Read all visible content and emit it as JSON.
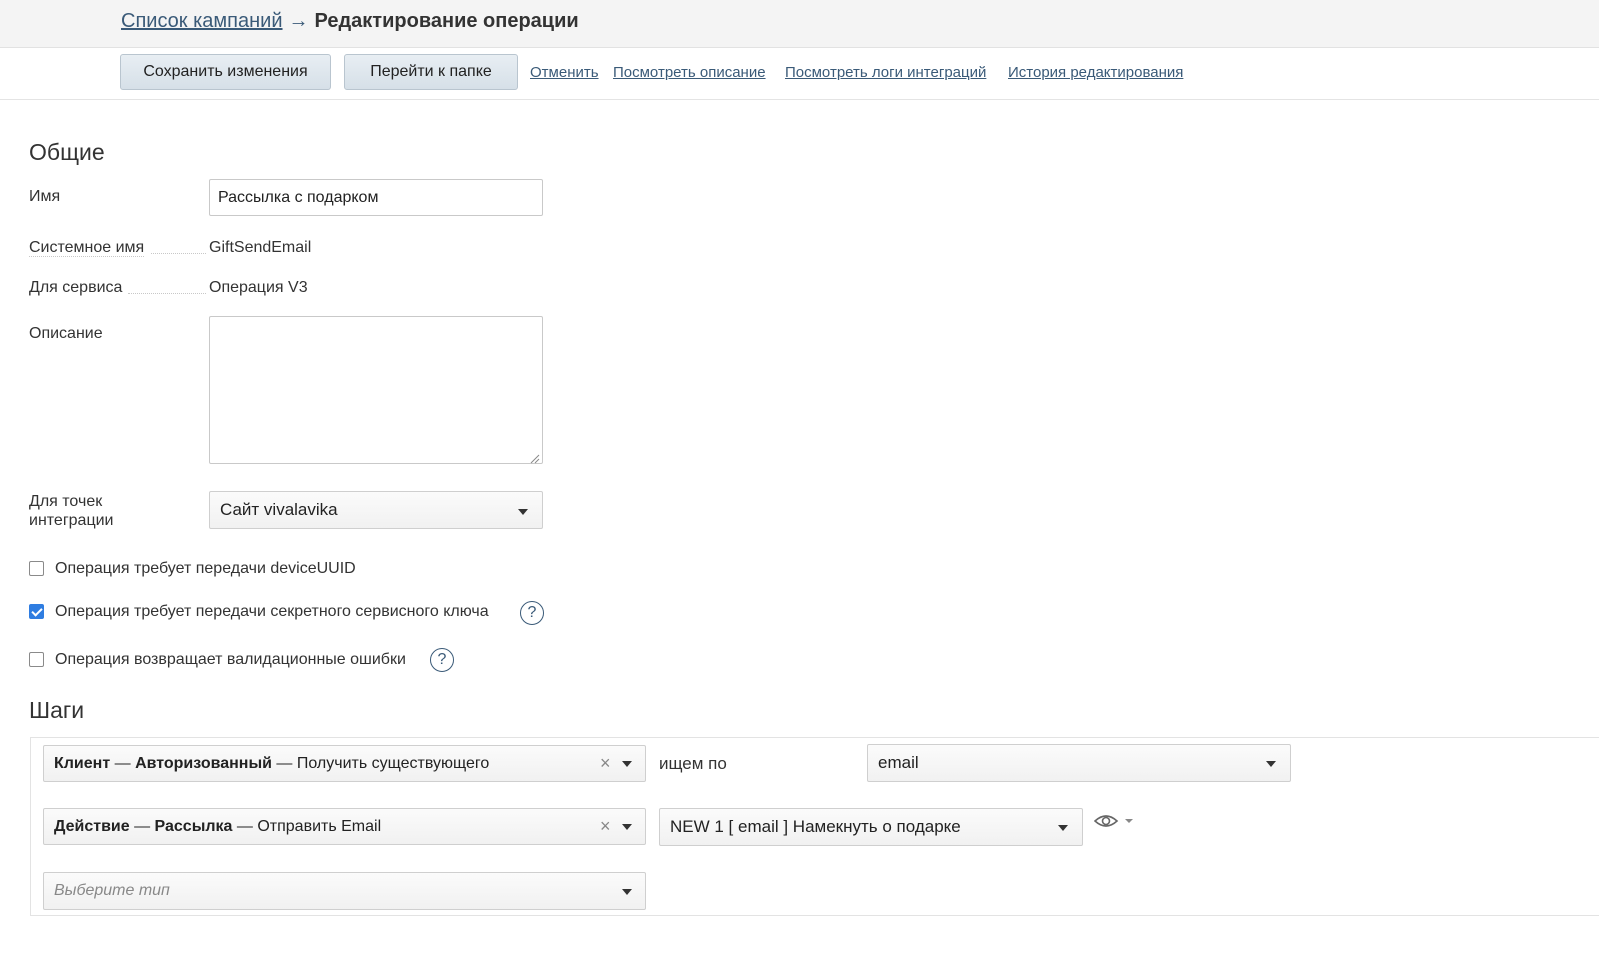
{
  "breadcrumb": {
    "link": "Список кампаний",
    "arrow": "→",
    "current": "Редактирование операции"
  },
  "toolbar": {
    "save_label": "Сохранить изменения",
    "folder_label": "Перейти к папке",
    "cancel_link": "Отменить",
    "view_description_link": "Посмотреть описание",
    "view_logs_link": "Посмотреть логи интеграций",
    "history_link": "История редактирования"
  },
  "general": {
    "heading": "Общие",
    "name_label": "Имя",
    "name_value": "Рассылка с подарком",
    "system_name_label": "Системное имя",
    "system_name_value": "GiftSendEmail",
    "service_label": "Для сервиса",
    "service_value": "Операция V3",
    "description_label": "Описание",
    "description_value": "",
    "integration_label_line1": "Для точек",
    "integration_label_line2": "интеграции",
    "integration_value": "Сайт vivalavika"
  },
  "checkboxes": [
    {
      "label": "Операция требует передачи deviceUUID",
      "checked": false
    },
    {
      "label": "Операция требует передачи секретного сервисного ключа",
      "checked": true,
      "help": "?"
    },
    {
      "label": "Операция возвращает валидационные ошибки",
      "checked": false,
      "help": "?"
    }
  ],
  "steps": {
    "heading": "Шаги",
    "row1": {
      "type_part1": "Клиент",
      "sep": "—",
      "type_part2": "Авторизованный",
      "type_part3": "Получить существующего",
      "connector": "ищем по",
      "param_value": "email"
    },
    "row2": {
      "type_part1": "Действие",
      "sep": "—",
      "type_part2": "Рассылка",
      "type_part3": "Отправить Email",
      "param_value": "NEW 1 [ email ] Намекнуть о подарке"
    },
    "row3": {
      "placeholder": "Выберите тип"
    }
  },
  "icons": {
    "clear": "×",
    "eye": "eye-icon",
    "caret": "chevron-down-icon"
  },
  "colors": {
    "link": "#3a5a78",
    "checkbox_checked": "#2f7de1"
  }
}
